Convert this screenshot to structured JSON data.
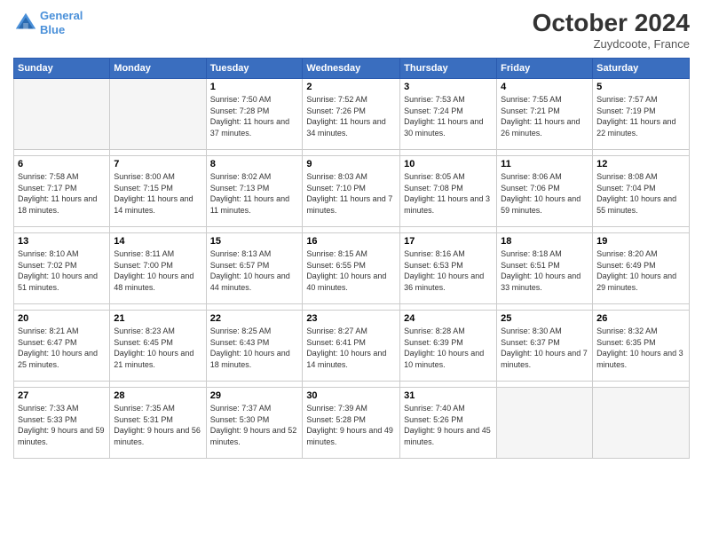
{
  "header": {
    "logo_line1": "General",
    "logo_line2": "Blue",
    "month": "October 2024",
    "location": "Zuydcoote, France"
  },
  "weekdays": [
    "Sunday",
    "Monday",
    "Tuesday",
    "Wednesday",
    "Thursday",
    "Friday",
    "Saturday"
  ],
  "weeks": [
    [
      {
        "day": "",
        "sunrise": "",
        "sunset": "",
        "daylight": "",
        "empty": true
      },
      {
        "day": "",
        "sunrise": "",
        "sunset": "",
        "daylight": "",
        "empty": true
      },
      {
        "day": "1",
        "sunrise": "Sunrise: 7:50 AM",
        "sunset": "Sunset: 7:28 PM",
        "daylight": "Daylight: 11 hours and 37 minutes.",
        "empty": false
      },
      {
        "day": "2",
        "sunrise": "Sunrise: 7:52 AM",
        "sunset": "Sunset: 7:26 PM",
        "daylight": "Daylight: 11 hours and 34 minutes.",
        "empty": false
      },
      {
        "day": "3",
        "sunrise": "Sunrise: 7:53 AM",
        "sunset": "Sunset: 7:24 PM",
        "daylight": "Daylight: 11 hours and 30 minutes.",
        "empty": false
      },
      {
        "day": "4",
        "sunrise": "Sunrise: 7:55 AM",
        "sunset": "Sunset: 7:21 PM",
        "daylight": "Daylight: 11 hours and 26 minutes.",
        "empty": false
      },
      {
        "day": "5",
        "sunrise": "Sunrise: 7:57 AM",
        "sunset": "Sunset: 7:19 PM",
        "daylight": "Daylight: 11 hours and 22 minutes.",
        "empty": false
      }
    ],
    [
      {
        "day": "6",
        "sunrise": "Sunrise: 7:58 AM",
        "sunset": "Sunset: 7:17 PM",
        "daylight": "Daylight: 11 hours and 18 minutes.",
        "empty": false
      },
      {
        "day": "7",
        "sunrise": "Sunrise: 8:00 AM",
        "sunset": "Sunset: 7:15 PM",
        "daylight": "Daylight: 11 hours and 14 minutes.",
        "empty": false
      },
      {
        "day": "8",
        "sunrise": "Sunrise: 8:02 AM",
        "sunset": "Sunset: 7:13 PM",
        "daylight": "Daylight: 11 hours and 11 minutes.",
        "empty": false
      },
      {
        "day": "9",
        "sunrise": "Sunrise: 8:03 AM",
        "sunset": "Sunset: 7:10 PM",
        "daylight": "Daylight: 11 hours and 7 minutes.",
        "empty": false
      },
      {
        "day": "10",
        "sunrise": "Sunrise: 8:05 AM",
        "sunset": "Sunset: 7:08 PM",
        "daylight": "Daylight: 11 hours and 3 minutes.",
        "empty": false
      },
      {
        "day": "11",
        "sunrise": "Sunrise: 8:06 AM",
        "sunset": "Sunset: 7:06 PM",
        "daylight": "Daylight: 10 hours and 59 minutes.",
        "empty": false
      },
      {
        "day": "12",
        "sunrise": "Sunrise: 8:08 AM",
        "sunset": "Sunset: 7:04 PM",
        "daylight": "Daylight: 10 hours and 55 minutes.",
        "empty": false
      }
    ],
    [
      {
        "day": "13",
        "sunrise": "Sunrise: 8:10 AM",
        "sunset": "Sunset: 7:02 PM",
        "daylight": "Daylight: 10 hours and 51 minutes.",
        "empty": false
      },
      {
        "day": "14",
        "sunrise": "Sunrise: 8:11 AM",
        "sunset": "Sunset: 7:00 PM",
        "daylight": "Daylight: 10 hours and 48 minutes.",
        "empty": false
      },
      {
        "day": "15",
        "sunrise": "Sunrise: 8:13 AM",
        "sunset": "Sunset: 6:57 PM",
        "daylight": "Daylight: 10 hours and 44 minutes.",
        "empty": false
      },
      {
        "day": "16",
        "sunrise": "Sunrise: 8:15 AM",
        "sunset": "Sunset: 6:55 PM",
        "daylight": "Daylight: 10 hours and 40 minutes.",
        "empty": false
      },
      {
        "day": "17",
        "sunrise": "Sunrise: 8:16 AM",
        "sunset": "Sunset: 6:53 PM",
        "daylight": "Daylight: 10 hours and 36 minutes.",
        "empty": false
      },
      {
        "day": "18",
        "sunrise": "Sunrise: 8:18 AM",
        "sunset": "Sunset: 6:51 PM",
        "daylight": "Daylight: 10 hours and 33 minutes.",
        "empty": false
      },
      {
        "day": "19",
        "sunrise": "Sunrise: 8:20 AM",
        "sunset": "Sunset: 6:49 PM",
        "daylight": "Daylight: 10 hours and 29 minutes.",
        "empty": false
      }
    ],
    [
      {
        "day": "20",
        "sunrise": "Sunrise: 8:21 AM",
        "sunset": "Sunset: 6:47 PM",
        "daylight": "Daylight: 10 hours and 25 minutes.",
        "empty": false
      },
      {
        "day": "21",
        "sunrise": "Sunrise: 8:23 AM",
        "sunset": "Sunset: 6:45 PM",
        "daylight": "Daylight: 10 hours and 21 minutes.",
        "empty": false
      },
      {
        "day": "22",
        "sunrise": "Sunrise: 8:25 AM",
        "sunset": "Sunset: 6:43 PM",
        "daylight": "Daylight: 10 hours and 18 minutes.",
        "empty": false
      },
      {
        "day": "23",
        "sunrise": "Sunrise: 8:27 AM",
        "sunset": "Sunset: 6:41 PM",
        "daylight": "Daylight: 10 hours and 14 minutes.",
        "empty": false
      },
      {
        "day": "24",
        "sunrise": "Sunrise: 8:28 AM",
        "sunset": "Sunset: 6:39 PM",
        "daylight": "Daylight: 10 hours and 10 minutes.",
        "empty": false
      },
      {
        "day": "25",
        "sunrise": "Sunrise: 8:30 AM",
        "sunset": "Sunset: 6:37 PM",
        "daylight": "Daylight: 10 hours and 7 minutes.",
        "empty": false
      },
      {
        "day": "26",
        "sunrise": "Sunrise: 8:32 AM",
        "sunset": "Sunset: 6:35 PM",
        "daylight": "Daylight: 10 hours and 3 minutes.",
        "empty": false
      }
    ],
    [
      {
        "day": "27",
        "sunrise": "Sunrise: 7:33 AM",
        "sunset": "Sunset: 5:33 PM",
        "daylight": "Daylight: 9 hours and 59 minutes.",
        "empty": false
      },
      {
        "day": "28",
        "sunrise": "Sunrise: 7:35 AM",
        "sunset": "Sunset: 5:31 PM",
        "daylight": "Daylight: 9 hours and 56 minutes.",
        "empty": false
      },
      {
        "day": "29",
        "sunrise": "Sunrise: 7:37 AM",
        "sunset": "Sunset: 5:30 PM",
        "daylight": "Daylight: 9 hours and 52 minutes.",
        "empty": false
      },
      {
        "day": "30",
        "sunrise": "Sunrise: 7:39 AM",
        "sunset": "Sunset: 5:28 PM",
        "daylight": "Daylight: 9 hours and 49 minutes.",
        "empty": false
      },
      {
        "day": "31",
        "sunrise": "Sunrise: 7:40 AM",
        "sunset": "Sunset: 5:26 PM",
        "daylight": "Daylight: 9 hours and 45 minutes.",
        "empty": false
      },
      {
        "day": "",
        "sunrise": "",
        "sunset": "",
        "daylight": "",
        "empty": true
      },
      {
        "day": "",
        "sunrise": "",
        "sunset": "",
        "daylight": "",
        "empty": true
      }
    ]
  ]
}
